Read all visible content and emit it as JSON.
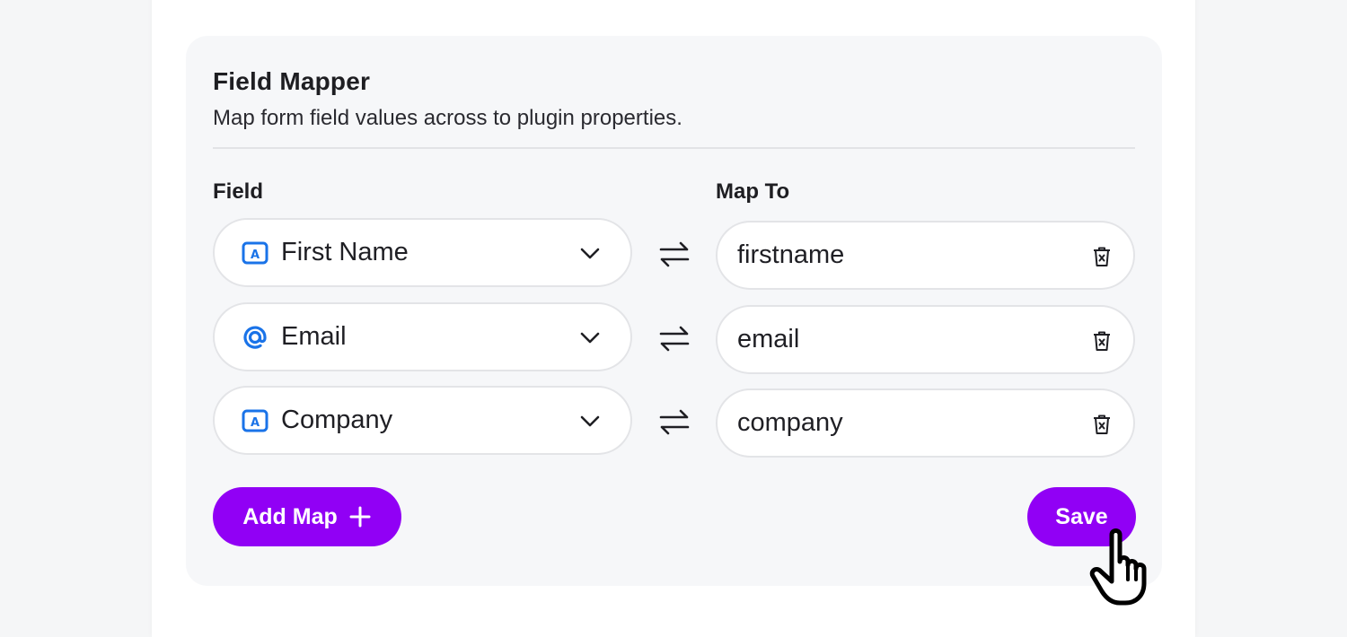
{
  "mapper": {
    "title": "Field Mapper",
    "subtitle": "Map form field values across to plugin properties.",
    "field_header": "Field",
    "map_header": "Map To",
    "rows": [
      {
        "field_label": "First Name",
        "field_icon": "text-field-icon",
        "map_value": "firstname"
      },
      {
        "field_label": "Email",
        "field_icon": "at-sign-icon",
        "map_value": "email"
      },
      {
        "field_label": "Company",
        "field_icon": "text-field-icon",
        "map_value": "company"
      }
    ],
    "add_label": "Add Map",
    "save_label": "Save"
  },
  "colors": {
    "accent": "#9100f5",
    "icon_blue": "#1a73e8",
    "panel_bg": "#f6f7f9"
  }
}
